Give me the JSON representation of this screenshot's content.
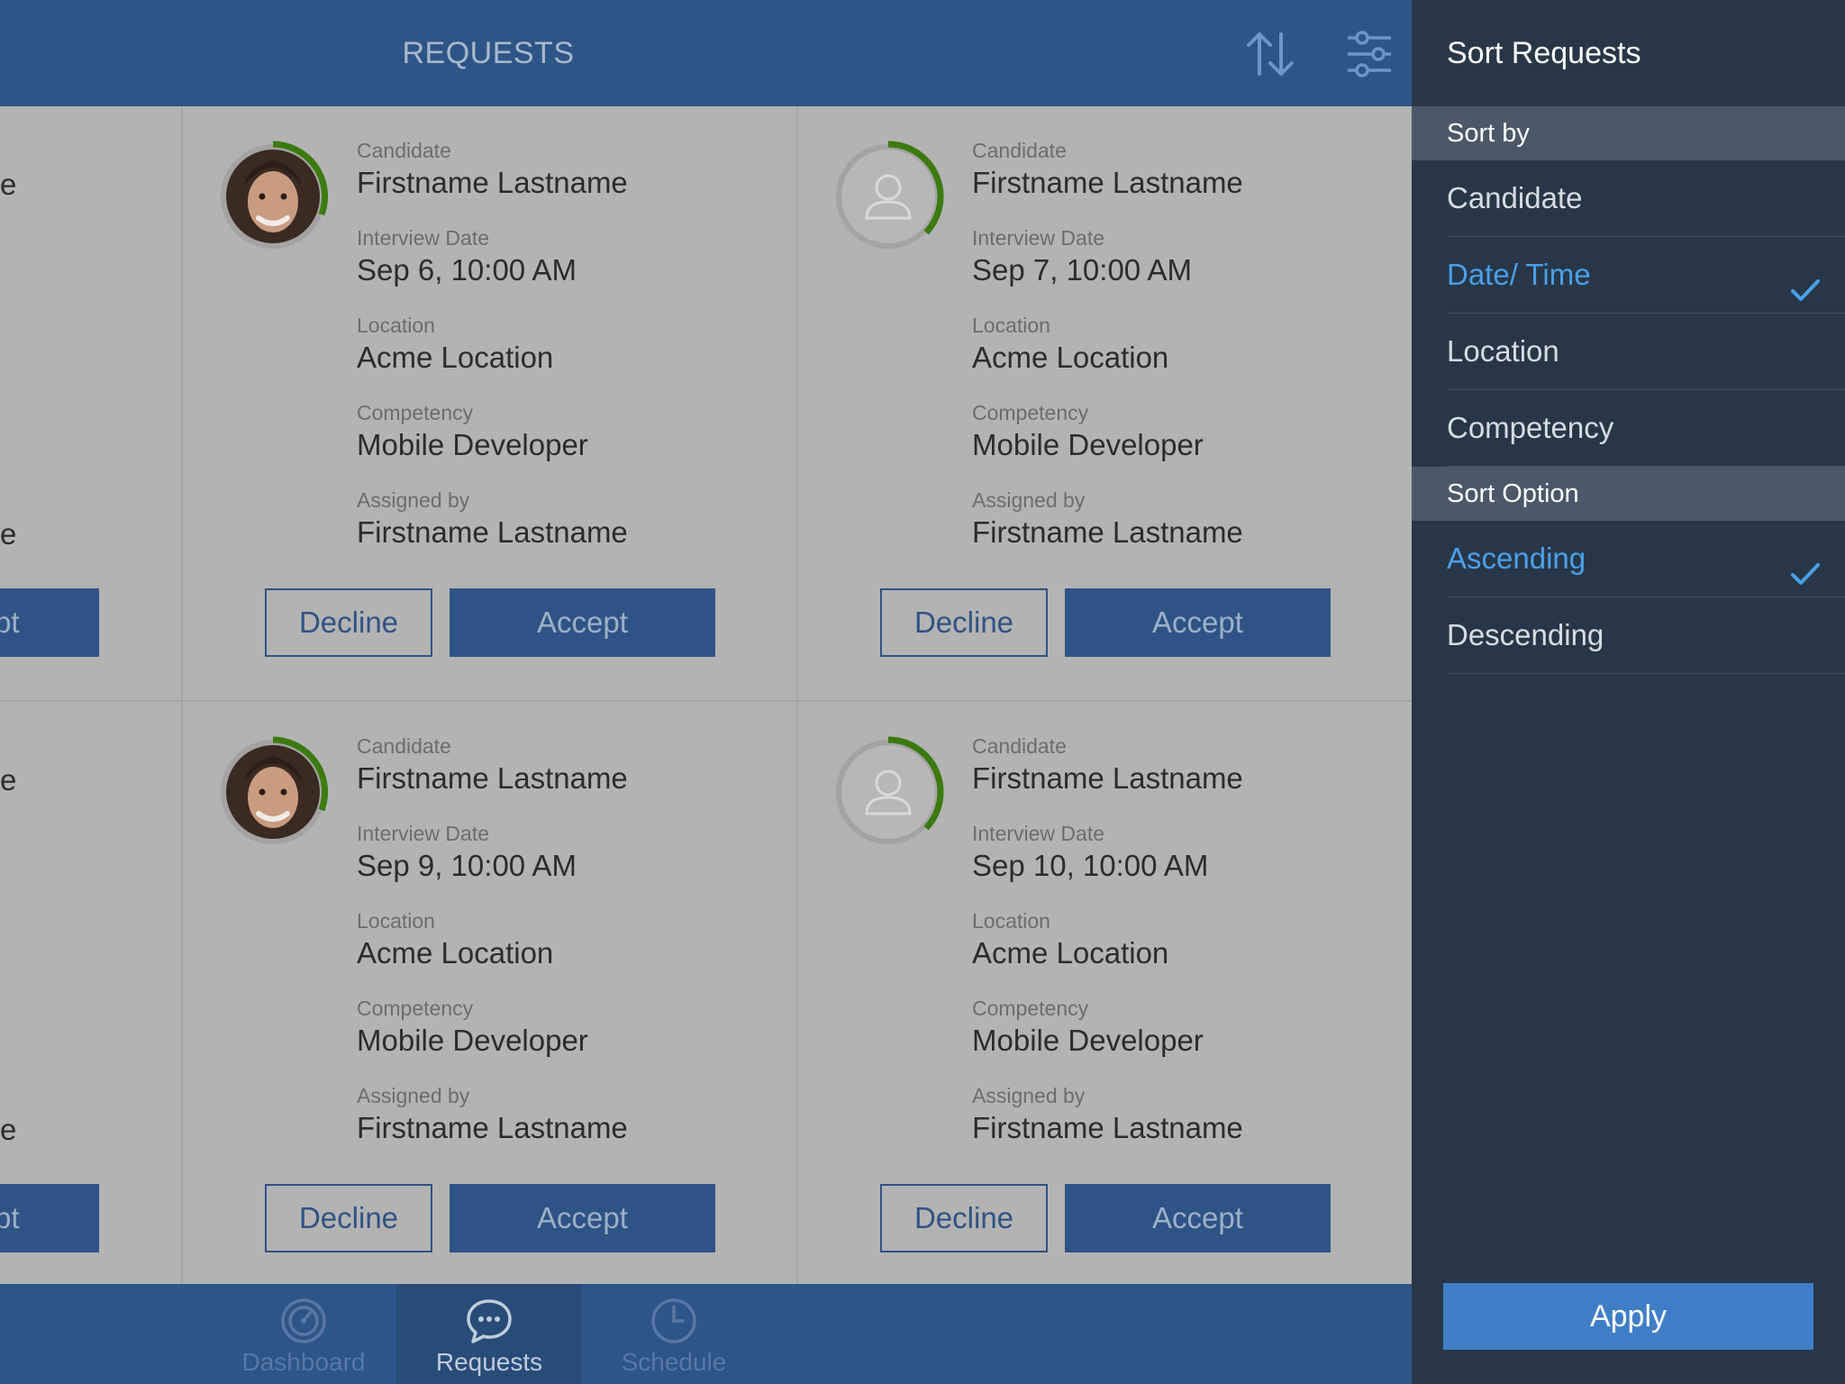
{
  "header": {
    "title": "REQUESTS",
    "sort_icon": "sort-arrows-icon",
    "filter_icon": "filter-sliders-icon"
  },
  "field_labels": {
    "candidate": "Candidate",
    "interview_date": "Interview Date",
    "location": "Location",
    "competency": "Competency",
    "assigned_by": "Assigned by"
  },
  "cards": [
    {
      "avatar": "photo",
      "candidate": "Firstname Lastname",
      "interview_date": "Sep 6,  10:00 AM",
      "location": "Acme Location",
      "competency": "Mobile Developer",
      "assigned_by": "Firstname Lastname",
      "decline_label": "Decline",
      "accept_label": "Accept"
    },
    {
      "avatar": "placeholder",
      "candidate": "Firstname Lastname",
      "interview_date": "Sep 7,  10:00 AM",
      "location": "Acme Location",
      "competency": "Mobile Developer",
      "assigned_by": "Firstname Lastname",
      "decline_label": "Decline",
      "accept_label": "Accept"
    },
    {
      "avatar": "photo",
      "candidate": "Firstname Lastname",
      "interview_date": "Sep 9,  10:00 AM",
      "location": "Acme Location",
      "competency": "Mobile Developer",
      "assigned_by": "Firstname Lastname",
      "decline_label": "Decline",
      "accept_label": "Accept"
    },
    {
      "avatar": "placeholder",
      "candidate": "Firstname Lastname",
      "interview_date": "Sep 10,  10:00 AM",
      "location": "Acme Location",
      "competency": "Mobile Developer",
      "assigned_by": "Firstname Lastname",
      "decline_label": "Decline",
      "accept_label": "Accept"
    }
  ],
  "partial_column": {
    "text_fragment": "e",
    "button_fragment": "pt"
  },
  "tabbar": {
    "tabs": [
      {
        "label": "Dashboard",
        "icon": "gauge-icon",
        "active": false
      },
      {
        "label": "Requests",
        "icon": "chat-bubble-icon",
        "active": true
      },
      {
        "label": "Schedule",
        "icon": "clock-icon",
        "active": false
      }
    ]
  },
  "sort_panel": {
    "title": "Sort Requests",
    "sort_by_heading": "Sort by",
    "sort_by_options": [
      {
        "label": "Candidate",
        "selected": false
      },
      {
        "label": "Date/ Time",
        "selected": true
      },
      {
        "label": "Location",
        "selected": false
      },
      {
        "label": "Competency",
        "selected": false
      }
    ],
    "sort_option_heading": "Sort Option",
    "sort_order_options": [
      {
        "label": "Ascending",
        "selected": true
      },
      {
        "label": "Descending",
        "selected": false
      }
    ],
    "apply_label": "Apply"
  },
  "colors": {
    "header_blue": "#2e5587",
    "accent_blue": "#4a9fe8",
    "progress_green": "#3c7a0f",
    "panel_bg": "#283748"
  }
}
